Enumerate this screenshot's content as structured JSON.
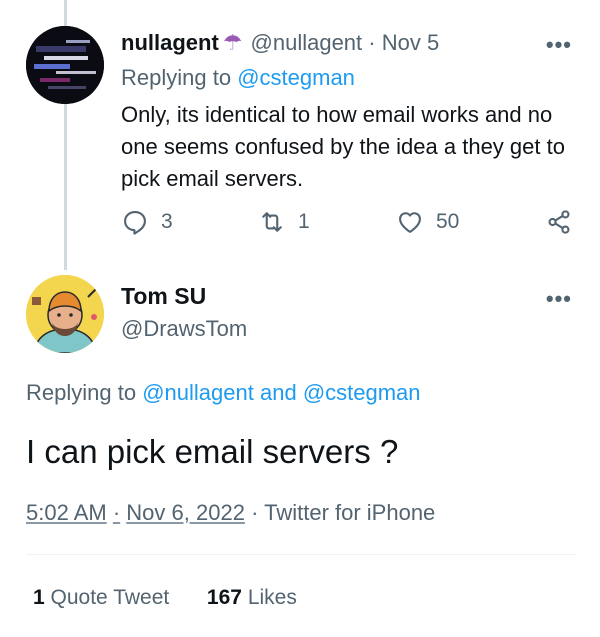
{
  "reply_tweet": {
    "author_name": "nullagent",
    "author_emoji": "☂",
    "handle": "@nullagent",
    "separator": "·",
    "date": "Nov 5",
    "more": "•••",
    "replying_prefix": "Replying to",
    "replying_handle": "@cstegman",
    "text": "Only, its identical to how email works and no one seems confused by the idea a they get to pick email servers.",
    "replies": "3",
    "retweets": "1",
    "likes": "50"
  },
  "main_tweet": {
    "author_name": "Tom SU",
    "handle": "@DrawsTom",
    "more": "•••",
    "replying_prefix": "Replying to",
    "replying_handle_1": "@nullagent",
    "replying_and": "and",
    "replying_handle_2": "@cstegman",
    "text": "I can pick email servers ?",
    "time": "5:02 AM",
    "separator": "·",
    "date": "Nov 6, 2022",
    "source": "Twitter for iPhone",
    "quote_count": "1",
    "quote_label": "Quote Tweet",
    "likes_count": "167",
    "likes_label": "Likes"
  },
  "colors": {
    "accent": "#1d9bf0",
    "muted": "#536471",
    "umbrella": "#9b59b6"
  },
  "icons": [
    "reply-icon",
    "retweet-icon",
    "like-icon",
    "share-icon",
    "more-icon",
    "umbrella-emoji"
  ]
}
